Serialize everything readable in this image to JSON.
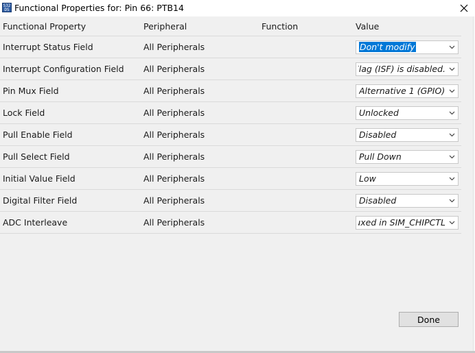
{
  "window": {
    "title": "Functional Properties for: Pin 66: PTB14",
    "app_icon_text": "S32 DS"
  },
  "table": {
    "headers": {
      "property": "Functional Property",
      "peripheral": "Peripheral",
      "function": "Function",
      "value": "Value"
    },
    "rows": [
      {
        "property": "Interrupt Status Field",
        "peripheral": "All Peripherals",
        "function": "",
        "value": "Don't modify",
        "selected": true
      },
      {
        "property": "Interrupt Configuration Field",
        "peripheral": "All Peripherals",
        "function": "",
        "value": "s Flag (ISF) is disabled.",
        "clipped_left": true
      },
      {
        "property": "Pin Mux Field",
        "peripheral": "All Peripherals",
        "function": "",
        "value": "Alternative 1 (GPIO)."
      },
      {
        "property": "Lock Field",
        "peripheral": "All Peripherals",
        "function": "",
        "value": "Unlocked"
      },
      {
        "property": "Pull Enable Field",
        "peripheral": "All Peripherals",
        "function": "",
        "value": "Disabled"
      },
      {
        "property": "Pull Select Field",
        "peripheral": "All Peripherals",
        "function": "",
        "value": "Pull Down"
      },
      {
        "property": "Initial Value Field",
        "peripheral": "All Peripherals",
        "function": "",
        "value": "Low"
      },
      {
        "property": "Digital Filter Field",
        "peripheral": "All Peripherals",
        "function": "",
        "value": "Disabled"
      },
      {
        "property": "ADC Interleave",
        "peripheral": "All Peripherals",
        "function": "",
        "value": "ıuxed in SIM_CHIPCTL",
        "clipped_left": true
      }
    ]
  },
  "buttons": {
    "done": "Done"
  },
  "colors": {
    "selection": "#0078d7",
    "window_bg": "#f0f0f0",
    "grid_line": "#dadada"
  }
}
